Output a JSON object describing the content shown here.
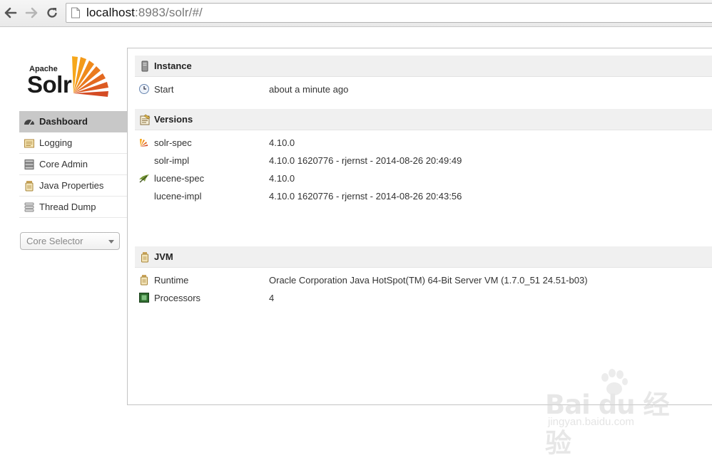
{
  "browser": {
    "url_host": "localhost",
    "url_rest": ":8983/solr/#/"
  },
  "logo": {
    "apache": "Apache",
    "solr": "Solr"
  },
  "sidebar": {
    "items": [
      {
        "label": "Dashboard",
        "icon": "dashboard-icon",
        "active": true
      },
      {
        "label": "Logging",
        "icon": "logging-icon"
      },
      {
        "label": "Core Admin",
        "icon": "core-admin-icon"
      },
      {
        "label": "Java Properties",
        "icon": "java-properties-icon"
      },
      {
        "label": "Thread Dump",
        "icon": "thread-dump-icon"
      }
    ],
    "core_selector": "Core Selector"
  },
  "instance": {
    "title": "Instance",
    "rows": [
      {
        "label": "Start",
        "value": "about a minute ago",
        "icon": "clock-icon"
      }
    ]
  },
  "versions": {
    "title": "Versions",
    "rows": [
      {
        "label": "solr-spec",
        "value": "4.10.0",
        "icon": "solr-icon"
      },
      {
        "label": "solr-impl",
        "value": "4.10.0 1620776 - rjernst - 2014-08-26 20:49:49"
      },
      {
        "label": "lucene-spec",
        "value": "4.10.0",
        "icon": "lucene-icon"
      },
      {
        "label": "lucene-impl",
        "value": "4.10.0 1620776 - rjernst - 2014-08-26 20:43:56"
      }
    ]
  },
  "jvm": {
    "title": "JVM",
    "rows": [
      {
        "label": "Runtime",
        "value": "Oracle Corporation Java HotSpot(TM) 64-Bit Server VM (1.7.0_51 24.51-b03)",
        "icon": "jar-icon"
      },
      {
        "label": "Processors",
        "value": "4",
        "icon": "chip-icon"
      }
    ]
  },
  "watermark": {
    "main": "Bai du 经验",
    "sub": "jingyan.baidu.com"
  }
}
